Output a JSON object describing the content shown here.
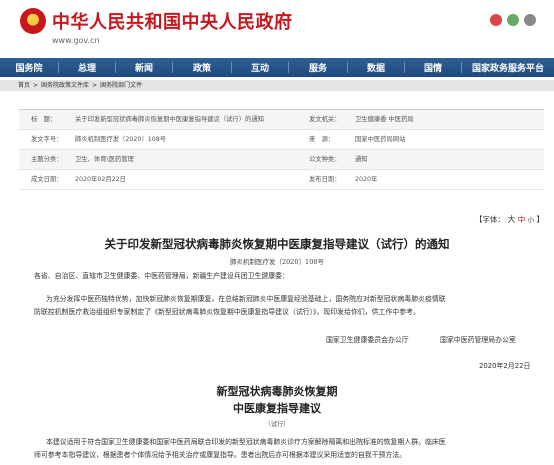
{
  "header": {
    "site_title": "中华人民共和国中央人民政府",
    "site_url": "www.gov.cn",
    "icons": [
      "weibo-icon",
      "wechat-icon",
      "app-icon"
    ]
  },
  "nav": {
    "items": [
      "国务院",
      "总理",
      "新闻",
      "政策",
      "互动",
      "服务",
      "数据",
      "国情",
      "国家政务服务平台"
    ]
  },
  "breadcrumb": [
    "首页",
    "国务院政策文件库",
    "国务院部门文件"
  ],
  "info": {
    "index_label": "标　题：",
    "title_value": "关于印发新型冠状病毒肺炎恢复期中医康复指导建议（试行）的通知",
    "issuer_label": "发文机关：",
    "issuer_value": "卫生健康委 中医药局",
    "number_label": "发文字号：",
    "number_value": "肺炎机制医疗发〔2020〕108号",
    "source_label": "来　源：",
    "source_value": "国家中医药局网站",
    "topic_label": "主题分类：",
    "topic_value": "卫生、体育\\医药管理",
    "type_label": "公文种类：",
    "type_value": "通知",
    "date_label": "成文日期：",
    "date_value": "2020年02月22日",
    "pub_label": "发布日期：",
    "pub_value": "2020年"
  },
  "font_size": {
    "label": "【字体：",
    "large": "大",
    "medium": "中",
    "small": "小",
    "end": "】"
  },
  "doc": {
    "title": "关于印发新型冠状病毒肺炎恢复期中医康复指导建议（试行）的通知",
    "number": "肺炎机制医疗发〔2020〕108号",
    "salutation": "各省、自治区、直辖市卫生健康委、中医药管理局，新疆生产建设兵团卫生健康委：",
    "para1_line1": "为充分发挥中医药独特优势，加快新冠肺炎恢复期康复，在总结新冠肺炎中医康复经验基础上，国务院应对新型冠状病毒肺炎疫情联",
    "para1_line2": "防联控机制医疗救治组组织专家制定了《新型冠状病毒肺炎恢复期中医康复指导建议（试行）》。现印发给你们，供工作中参考。",
    "signer1": "国家卫生健康委员会办公厅",
    "signer2": "国家中医药管理局办公室",
    "sign_date": "2020年2月22日",
    "sub_title1": "新型冠状病毒肺炎恢复期",
    "sub_title2": "中医康复指导建议",
    "trial": "（试行）",
    "para2_line1": "本建议适用于符合国家卫生健康委和国家中医药局联合印发的新型冠状病毒肺炎诊疗方案解除隔离和出院标准的恢复期人群。临床医",
    "para2_line2": "师可参考本指导建议，根据患者个体情况给予相关治疗或康复指导。患者出院后亦可根据本建议采用适宜的自我干预方法。"
  }
}
